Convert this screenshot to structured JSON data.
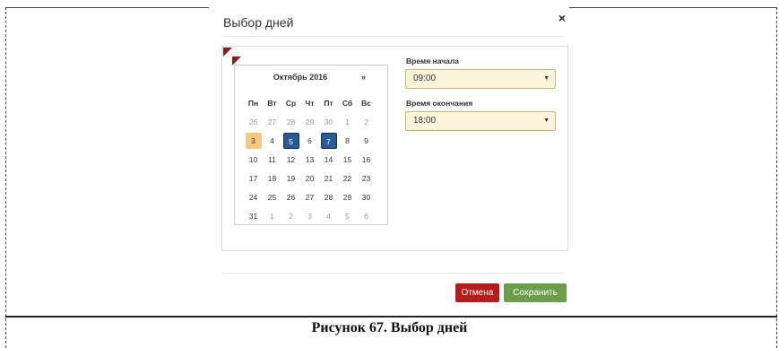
{
  "modal": {
    "title": "Выбор дней",
    "close_symbol": "×"
  },
  "calendar": {
    "month_title": "Октябрь 2016",
    "next_symbol": "»",
    "weekdays": [
      "Пн",
      "Вт",
      "Ср",
      "Чт",
      "Пт",
      "Сб",
      "Вс"
    ],
    "weeks": [
      [
        {
          "d": "26",
          "m": true
        },
        {
          "d": "27",
          "m": true
        },
        {
          "d": "28",
          "m": true
        },
        {
          "d": "29",
          "m": true
        },
        {
          "d": "30",
          "m": true
        },
        {
          "d": "1",
          "m": true
        },
        {
          "d": "2",
          "m": true
        }
      ],
      [
        {
          "d": "3",
          "s": "today"
        },
        {
          "d": "4"
        },
        {
          "d": "5",
          "s": "selected"
        },
        {
          "d": "6"
        },
        {
          "d": "7",
          "s": "selected"
        },
        {
          "d": "8"
        },
        {
          "d": "9"
        }
      ],
      [
        {
          "d": "10"
        },
        {
          "d": "11"
        },
        {
          "d": "12"
        },
        {
          "d": "13"
        },
        {
          "d": "14"
        },
        {
          "d": "15"
        },
        {
          "d": "16"
        }
      ],
      [
        {
          "d": "17"
        },
        {
          "d": "18"
        },
        {
          "d": "19"
        },
        {
          "d": "20"
        },
        {
          "d": "21"
        },
        {
          "d": "22"
        },
        {
          "d": "23"
        }
      ],
      [
        {
          "d": "24"
        },
        {
          "d": "25"
        },
        {
          "d": "26"
        },
        {
          "d": "27"
        },
        {
          "d": "28"
        },
        {
          "d": "29"
        },
        {
          "d": "30"
        }
      ],
      [
        {
          "d": "31"
        },
        {
          "d": "1",
          "m": true
        },
        {
          "d": "2",
          "m": true
        },
        {
          "d": "3",
          "m": true
        },
        {
          "d": "4",
          "m": true
        },
        {
          "d": "5",
          "m": true
        },
        {
          "d": "6",
          "m": true
        }
      ]
    ]
  },
  "start_time": {
    "label": "Время начала",
    "value": "09:00",
    "arrow": "▼"
  },
  "end_time": {
    "label": "Время окончания",
    "value": "18:00",
    "arrow": "▼"
  },
  "buttons": {
    "cancel": "Отмена",
    "save": "Сохранить"
  },
  "caption": "Рисунок 67. Выбор дней",
  "colors": {
    "selected_day": "#2a5b96",
    "today_day": "#f5c882",
    "cancel_button": "#b71c1c",
    "save_button": "#6a9e4a",
    "select_background": "#fcf4dd",
    "corner_flag": "#8b1a1a"
  }
}
